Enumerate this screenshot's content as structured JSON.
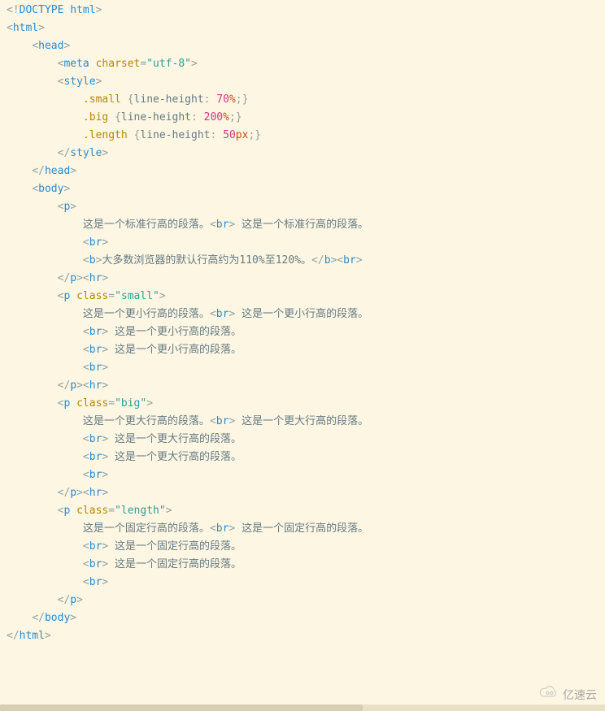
{
  "lines": [
    [
      [
        "p",
        "<!"
      ],
      [
        "t",
        "DOCTYPE html"
      ],
      [
        "p",
        ">"
      ]
    ],
    [
      [
        "p",
        "<"
      ],
      [
        "t",
        "html"
      ],
      [
        "p",
        ">"
      ]
    ],
    [
      [
        "x",
        "    "
      ],
      [
        "p",
        "<"
      ],
      [
        "t",
        "head"
      ],
      [
        "p",
        ">"
      ]
    ],
    [
      [
        "x",
        "        "
      ],
      [
        "p",
        "<"
      ],
      [
        "t",
        "meta"
      ],
      [
        "x",
        " "
      ],
      [
        "a",
        "charset"
      ],
      [
        "p",
        "="
      ],
      [
        "s",
        "\"utf-8\""
      ],
      [
        "p",
        ">"
      ]
    ],
    [
      [
        "x",
        "        "
      ],
      [
        "p",
        "<"
      ],
      [
        "t",
        "style"
      ],
      [
        "p",
        ">"
      ]
    ],
    [
      [
        "x",
        "            "
      ],
      [
        "sel",
        ".small"
      ],
      [
        "x",
        " "
      ],
      [
        "p",
        "{"
      ],
      [
        "prop",
        "line-height"
      ],
      [
        "p",
        ": "
      ],
      [
        "n",
        "70"
      ],
      [
        "u",
        "%"
      ],
      [
        "p",
        ";}"
      ]
    ],
    [
      [
        "x",
        ""
      ]
    ],
    [
      [
        "x",
        "            "
      ],
      [
        "sel",
        ".big"
      ],
      [
        "x",
        " "
      ],
      [
        "p",
        "{"
      ],
      [
        "prop",
        "line-height"
      ],
      [
        "p",
        ": "
      ],
      [
        "n",
        "200"
      ],
      [
        "u",
        "%"
      ],
      [
        "p",
        ";}"
      ]
    ],
    [
      [
        "x",
        ""
      ]
    ],
    [
      [
        "x",
        "            "
      ],
      [
        "sel",
        ".length"
      ],
      [
        "x",
        " "
      ],
      [
        "p",
        "{"
      ],
      [
        "prop",
        "line-height"
      ],
      [
        "p",
        ": "
      ],
      [
        "n",
        "50"
      ],
      [
        "u",
        "px"
      ],
      [
        "p",
        ";}"
      ]
    ],
    [
      [
        "x",
        "        "
      ],
      [
        "p",
        "</"
      ],
      [
        "t",
        "style"
      ],
      [
        "p",
        ">"
      ]
    ],
    [
      [
        "x",
        "    "
      ],
      [
        "p",
        "</"
      ],
      [
        "t",
        "head"
      ],
      [
        "p",
        ">"
      ]
    ],
    [
      [
        "x",
        ""
      ]
    ],
    [
      [
        "x",
        "    "
      ],
      [
        "p",
        "<"
      ],
      [
        "t",
        "body"
      ],
      [
        "p",
        ">"
      ]
    ],
    [
      [
        "x",
        "        "
      ],
      [
        "p",
        "<"
      ],
      [
        "t",
        "p"
      ],
      [
        "p",
        ">"
      ]
    ],
    [
      [
        "x",
        "            "
      ],
      [
        "txt",
        "这是一个标准行高的段落。"
      ],
      [
        "p",
        "<"
      ],
      [
        "t",
        "br"
      ],
      [
        "p",
        ">"
      ],
      [
        "txt",
        " 这是一个标准行高的段落。"
      ]
    ],
    [
      [
        "x",
        "            "
      ],
      [
        "p",
        "<"
      ],
      [
        "t",
        "br"
      ],
      [
        "p",
        ">"
      ]
    ],
    [
      [
        "x",
        "            "
      ],
      [
        "p",
        "<"
      ],
      [
        "t",
        "b"
      ],
      [
        "p",
        ">"
      ],
      [
        "txt",
        "大多数浏览器的默认行高约为110%至120%。"
      ],
      [
        "p",
        "</"
      ],
      [
        "t",
        "b"
      ],
      [
        "p",
        "><"
      ],
      [
        "t",
        "br"
      ],
      [
        "p",
        ">"
      ]
    ],
    [
      [
        "x",
        "        "
      ],
      [
        "p",
        "</"
      ],
      [
        "t",
        "p"
      ],
      [
        "p",
        "><"
      ],
      [
        "t",
        "hr"
      ],
      [
        "p",
        ">"
      ]
    ],
    [
      [
        "x",
        "        "
      ],
      [
        "p",
        "<"
      ],
      [
        "t",
        "p"
      ],
      [
        "x",
        " "
      ],
      [
        "a",
        "class"
      ],
      [
        "p",
        "="
      ],
      [
        "s",
        "\"small\""
      ],
      [
        "p",
        ">"
      ]
    ],
    [
      [
        "x",
        "            "
      ],
      [
        "txt",
        "这是一个更小行高的段落。"
      ],
      [
        "p",
        "<"
      ],
      [
        "t",
        "br"
      ],
      [
        "p",
        ">"
      ],
      [
        "txt",
        " 这是一个更小行高的段落。"
      ]
    ],
    [
      [
        "x",
        "            "
      ],
      [
        "p",
        "<"
      ],
      [
        "t",
        "br"
      ],
      [
        "p",
        ">"
      ],
      [
        "txt",
        " 这是一个更小行高的段落。"
      ]
    ],
    [
      [
        "x",
        "            "
      ],
      [
        "p",
        "<"
      ],
      [
        "t",
        "br"
      ],
      [
        "p",
        ">"
      ],
      [
        "txt",
        " 这是一个更小行高的段落。"
      ]
    ],
    [
      [
        "x",
        "            "
      ],
      [
        "p",
        "<"
      ],
      [
        "t",
        "br"
      ],
      [
        "p",
        ">"
      ]
    ],
    [
      [
        "x",
        "        "
      ],
      [
        "p",
        "</"
      ],
      [
        "t",
        "p"
      ],
      [
        "p",
        "><"
      ],
      [
        "t",
        "hr"
      ],
      [
        "p",
        ">"
      ]
    ],
    [
      [
        "x",
        "        "
      ],
      [
        "p",
        "<"
      ],
      [
        "t",
        "p"
      ],
      [
        "x",
        " "
      ],
      [
        "a",
        "class"
      ],
      [
        "p",
        "="
      ],
      [
        "s",
        "\"big\""
      ],
      [
        "p",
        ">"
      ]
    ],
    [
      [
        "x",
        "            "
      ],
      [
        "txt",
        "这是一个更大行高的段落。"
      ],
      [
        "p",
        "<"
      ],
      [
        "t",
        "br"
      ],
      [
        "p",
        ">"
      ],
      [
        "txt",
        " 这是一个更大行高的段落。"
      ]
    ],
    [
      [
        "x",
        "            "
      ],
      [
        "p",
        "<"
      ],
      [
        "t",
        "br"
      ],
      [
        "p",
        ">"
      ],
      [
        "txt",
        " 这是一个更大行高的段落。"
      ]
    ],
    [
      [
        "x",
        "            "
      ],
      [
        "p",
        "<"
      ],
      [
        "t",
        "br"
      ],
      [
        "p",
        ">"
      ],
      [
        "txt",
        " 这是一个更大行高的段落。"
      ]
    ],
    [
      [
        "x",
        "            "
      ],
      [
        "p",
        "<"
      ],
      [
        "t",
        "br"
      ],
      [
        "p",
        ">"
      ]
    ],
    [
      [
        "x",
        "        "
      ],
      [
        "p",
        "</"
      ],
      [
        "t",
        "p"
      ],
      [
        "p",
        "><"
      ],
      [
        "t",
        "hr"
      ],
      [
        "p",
        ">"
      ]
    ],
    [
      [
        "x",
        "        "
      ],
      [
        "p",
        "<"
      ],
      [
        "t",
        "p"
      ],
      [
        "x",
        " "
      ],
      [
        "a",
        "class"
      ],
      [
        "p",
        "="
      ],
      [
        "s",
        "\"length\""
      ],
      [
        "p",
        ">"
      ]
    ],
    [
      [
        "x",
        "            "
      ],
      [
        "txt",
        "这是一个固定行高的段落。"
      ],
      [
        "p",
        "<"
      ],
      [
        "t",
        "br"
      ],
      [
        "p",
        ">"
      ],
      [
        "txt",
        " 这是一个固定行高的段落。"
      ]
    ],
    [
      [
        "x",
        "            "
      ],
      [
        "p",
        "<"
      ],
      [
        "t",
        "br"
      ],
      [
        "p",
        ">"
      ],
      [
        "txt",
        " 这是一个固定行高的段落。"
      ]
    ],
    [
      [
        "x",
        "            "
      ],
      [
        "p",
        "<"
      ],
      [
        "t",
        "br"
      ],
      [
        "p",
        ">"
      ],
      [
        "txt",
        " 这是一个固定行高的段落。"
      ]
    ],
    [
      [
        "x",
        "            "
      ],
      [
        "p",
        "<"
      ],
      [
        "t",
        "br"
      ],
      [
        "p",
        ">"
      ]
    ],
    [
      [
        "x",
        "        "
      ],
      [
        "p",
        "</"
      ],
      [
        "t",
        "p"
      ],
      [
        "p",
        ">"
      ]
    ],
    [
      [
        "x",
        "    "
      ],
      [
        "p",
        "</"
      ],
      [
        "t",
        "body"
      ],
      [
        "p",
        ">"
      ]
    ],
    [
      [
        "p",
        "</"
      ],
      [
        "t",
        "html"
      ],
      [
        "p",
        ">"
      ]
    ]
  ],
  "watermark": "亿速云"
}
